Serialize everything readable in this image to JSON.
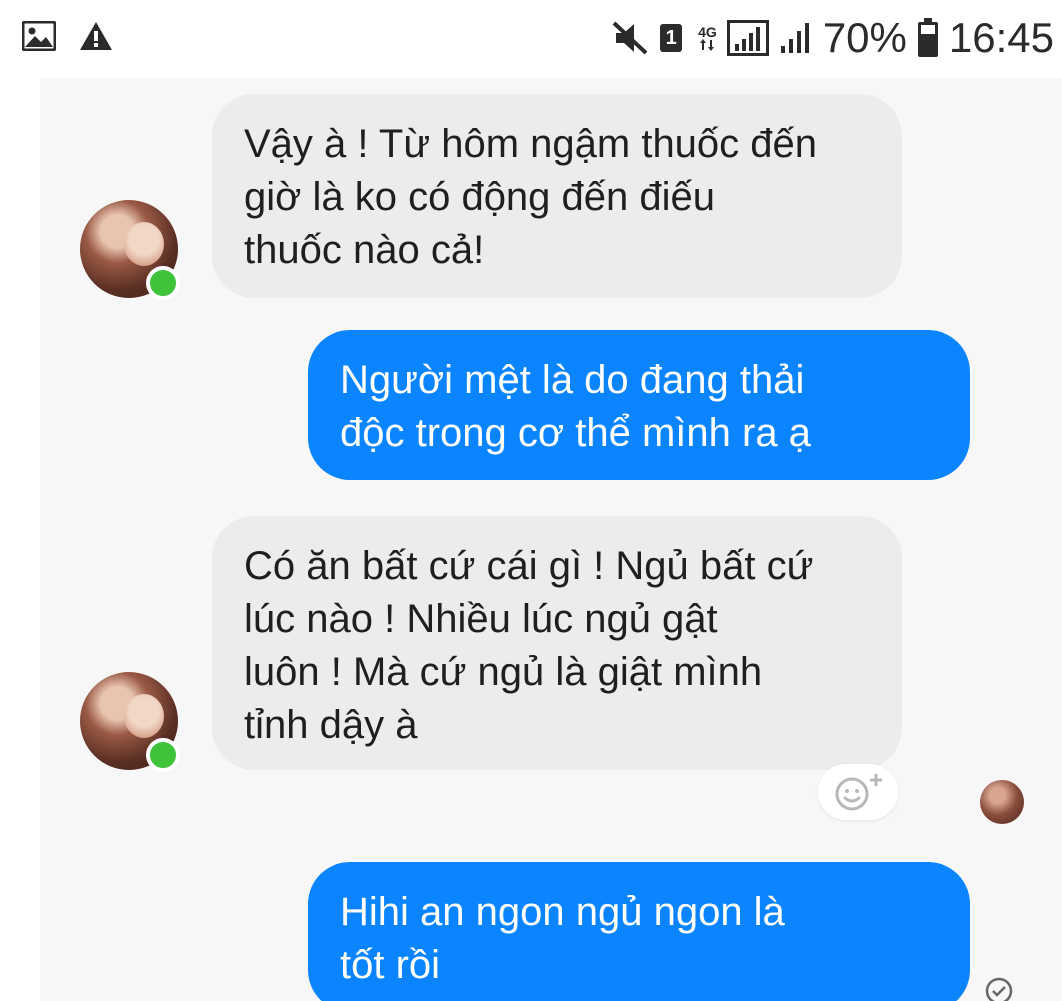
{
  "status_bar": {
    "left_icons": [
      "image-icon",
      "warning-icon"
    ],
    "mute_icon": "mute-icon",
    "sim": "1",
    "network": "4G",
    "battery_percent": "70%",
    "time": "16:45"
  },
  "messages": [
    {
      "direction": "incoming",
      "lines": [
        "Vậy à ! Từ hôm ngậm thuốc đến",
        "giờ là ko có động đến điếu",
        "thuốc nào cả!"
      ]
    },
    {
      "direction": "outgoing",
      "lines": [
        "Người  mệt  là  do  đang thải",
        "độc  trong  cơ thể  mình  ra  ạ"
      ]
    },
    {
      "direction": "incoming",
      "lines": [
        "Có ăn bất cứ cái gì ! Ngủ bất cứ",
        "lúc nào ! Nhiều lúc ngủ gật",
        "luôn ! Mà cứ ngủ là giật mình",
        "tỉnh dậy à"
      ]
    },
    {
      "direction": "outgoing",
      "lines": [
        "Hihi  an ngon  ngủ  ngon  là",
        "tốt rồi"
      ]
    }
  ],
  "colors": {
    "incoming_bubble": "#ececec",
    "outgoing_bubble": "#0a84ff",
    "online_dot": "#3ec33b"
  }
}
